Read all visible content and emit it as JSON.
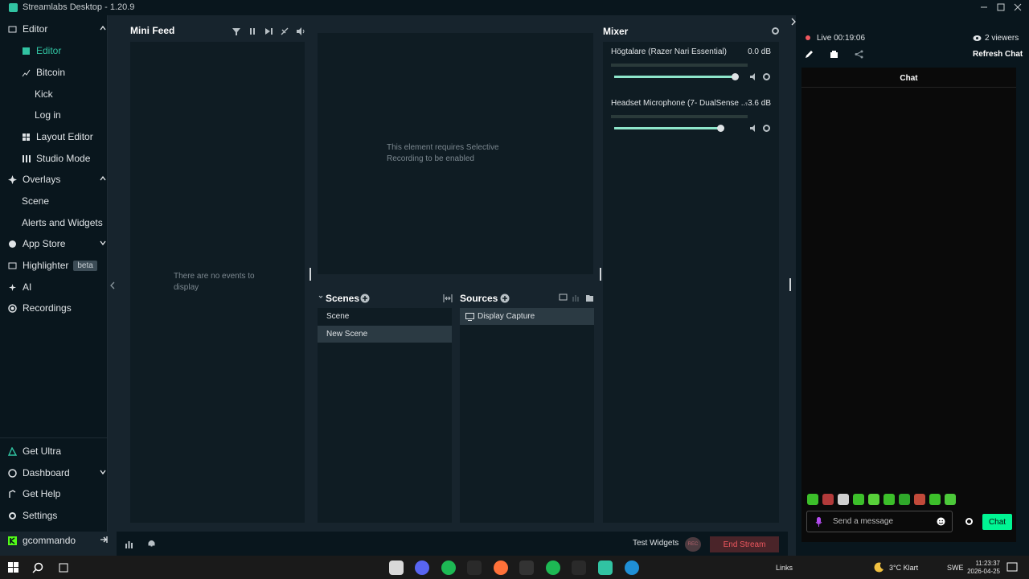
{
  "window": {
    "title": "Streamlabs Desktop - 1.20.9"
  },
  "nav": {
    "sections": [
      {
        "label": "Editor",
        "icon": "editor-icon"
      },
      {
        "label": "Editor",
        "icon": "editor-icon",
        "active": true
      },
      {
        "label": "Bitcoin",
        "icon": "chart-icon"
      },
      {
        "label": "Kick",
        "icon": "none"
      },
      {
        "label": "Log in",
        "icon": "none"
      },
      {
        "label": "Layout Editor",
        "icon": "layout-icon"
      },
      {
        "label": "Studio Mode",
        "icon": "studio-icon"
      },
      {
        "label": "Overlays",
        "icon": "overlays-icon"
      },
      {
        "label": "Scene",
        "icon": "none"
      },
      {
        "label": "Alerts and Widgets",
        "icon": "none"
      },
      {
        "label": "App Store",
        "icon": "store-icon"
      },
      {
        "label": "Highlighter",
        "icon": "highlighter-icon"
      },
      {
        "label": "AI",
        "icon": "ai-icon"
      },
      {
        "label": "Recordings",
        "icon": "recordings-icon"
      }
    ],
    "beta_badge": "beta",
    "bottom": [
      {
        "label": "Get Ultra",
        "icon": "ultra-icon"
      },
      {
        "label": "Dashboard",
        "icon": "dashboard-icon"
      },
      {
        "label": "Get Help",
        "icon": "help-icon"
      },
      {
        "label": "Settings",
        "icon": "gear-icon"
      }
    ],
    "user": "gcommando"
  },
  "minifeed": {
    "title": "Mini Feed",
    "empty": "There are no events to display"
  },
  "preview": {
    "message": "This element requires Selective Recording to be enabled"
  },
  "scenes": {
    "title": "Scenes",
    "items": [
      "Scene",
      "New Scene"
    ],
    "selected_index": 1
  },
  "sources": {
    "title": "Sources",
    "items": [
      "Display Capture"
    ]
  },
  "mixer": {
    "title": "Mixer",
    "channels": [
      {
        "name": "Högtalare (Razer Nari Essential)",
        "db": "0.0 dB",
        "level": 1.0
      },
      {
        "name": "Headset Microphone (7- DualSense ...",
        "db": "-3.6 dB",
        "level": 0.88
      }
    ]
  },
  "bottombar": {
    "test_widgets": "Test Widgets",
    "rec": "REC",
    "end_stream": "End Stream"
  },
  "chat": {
    "live": "Live 00:19:06",
    "viewers": "2 viewers",
    "refresh": "Refresh Chat",
    "header": "Chat",
    "placeholder": "Send a message",
    "send": "Chat",
    "accent": "#00f593"
  },
  "taskbar": {
    "links": "Links",
    "weather": "3°C  Klart",
    "lang": "SWE",
    "time": "11:23:37",
    "date": "2026-04-25"
  },
  "colors": {
    "accent": "#31c3a2",
    "end_stream": "#f0585f"
  }
}
